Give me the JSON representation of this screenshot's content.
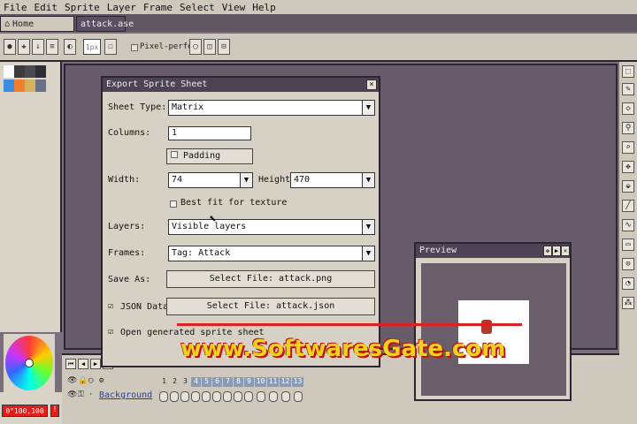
{
  "menu": [
    "File",
    "Edit",
    "Sprite",
    "Layer",
    "Frame",
    "Select",
    "View",
    "Help"
  ],
  "tabs": {
    "home": "Home",
    "document": "attack.ase"
  },
  "toolbar": {
    "brush_size": "1px",
    "pixel_perfect": "Pixel-perfect"
  },
  "dialog": {
    "title": "Export Sprite Sheet",
    "sheet_type_label": "Sheet Type:",
    "sheet_type_value": "Matrix",
    "columns_label": "Columns:",
    "columns_value": "1",
    "padding_label": "Padding",
    "width_label": "Width:",
    "width_value": "74",
    "height_label": "Height:",
    "height_value": "470",
    "best_fit_label": "Best fit for texture",
    "layers_label": "Layers:",
    "layers_value": "Visible layers",
    "frames_label": "Frames:",
    "frames_value": "Tag: Attack",
    "save_as_label": "Save As:",
    "save_as_button": "Select File: attack.png",
    "json_label": "JSON Data:",
    "json_button": "Select File: attack.json",
    "open_generated_label": "Open generated sprite sheet"
  },
  "preview": {
    "title": "Preview"
  },
  "timeline": {
    "frames": [
      "1",
      "2",
      "3",
      "4",
      "5",
      "6",
      "7",
      "8",
      "9",
      "10",
      "11",
      "12",
      "13"
    ],
    "layer_name": "Background"
  },
  "status": {
    "color_readout": "0°100,100",
    "warning": "!"
  },
  "watermark": "www.SoftwaresGate.com",
  "colors": {
    "palette": [
      "#ffffff",
      "#3b3b3b",
      "#4a4a55",
      "#2d2d35",
      "#3c8de0",
      "#f08030",
      "#d6b25e",
      "#6a6f8a"
    ],
    "title_bar": "#4d4355",
    "canvas": "#685c6a"
  }
}
